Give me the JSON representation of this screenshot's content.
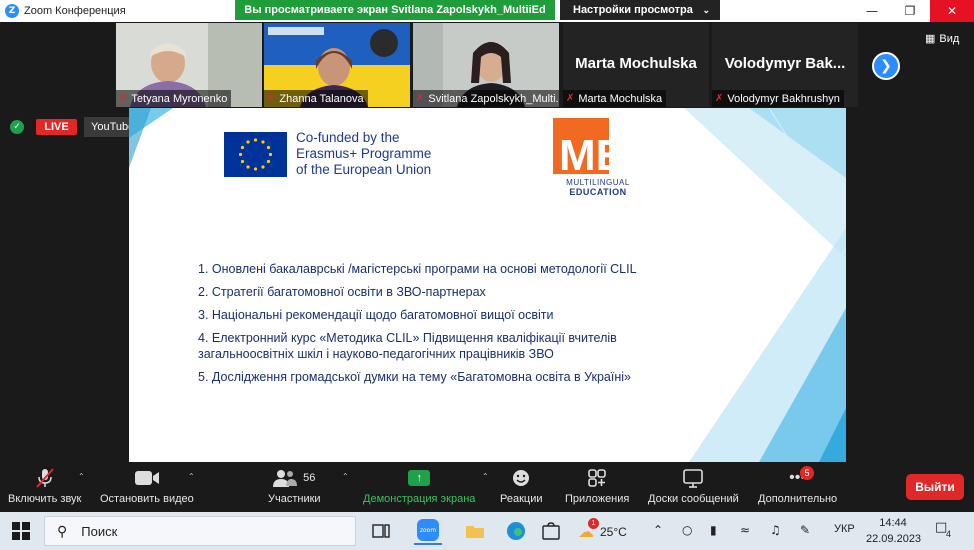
{
  "window": {
    "title": "Zoom Конференция",
    "share_banner": "Вы просматриваете экран Svitlana Zapolskykh_MultiiEd",
    "view_settings": "Настройки просмотра"
  },
  "gallery": {
    "participants": [
      {
        "name": "Tetyana Myronenko",
        "muted": true
      },
      {
        "name": "Zhanna Talanova",
        "muted": true
      },
      {
        "name": "Svitlana Zapolskykh_Multi...",
        "muted": true
      },
      {
        "name": "Marta Mochulska",
        "big_name": "Marta Mochulska",
        "muted": true
      },
      {
        "name": "Volodymyr Bakhrushyn",
        "big_name": "Volodymyr Bak...",
        "muted": true
      }
    ],
    "view_label": "Вид"
  },
  "live": {
    "badge": "LIVE",
    "platform": "YouTube"
  },
  "slide": {
    "cofunded_lines": [
      "Co-funded by the",
      "Erasmus+ Programme",
      "of the European Union"
    ],
    "logo_letters": "ME",
    "logo_sub1": "MULTILINGUAL",
    "logo_sub2": "EDUCATION",
    "items": [
      "1. Оновлені бакалаврські /магістерські програми на основі методології CLIL",
      "2. Стратегії багатомовної освіти в ЗВО-партнерах",
      "3. Національні рекомендації щодо багатомовної вищої освіти",
      "4. Електронний курс «Методика CLIL» Підвищення кваліфікації вчителів загальноосвітніх шкіл і науково-педагогічних працівників ЗВО",
      "5. Дослідження громадської думки на тему «Багатомовна освіта в Україні»"
    ]
  },
  "toolbar": {
    "audio": "Включить звук",
    "video": "Остановить видео",
    "participants": "Участники",
    "participants_count": "56",
    "share": "Демонстрация экрана",
    "reactions": "Реакции",
    "apps": "Приложения",
    "whiteboards": "Доски сообщений",
    "more": "Дополнительно",
    "more_badge": "5",
    "leave": "Выйти"
  },
  "taskbar": {
    "search_placeholder": "Поиск",
    "temperature": "25°C",
    "weather_badge": "1",
    "language": "УКР",
    "time": "14:44",
    "date": "22.09.2023",
    "notifications": "4"
  },
  "colors": {
    "zoom_blue": "#2d8cff",
    "share_green": "#1f9d3a",
    "leave_red": "#e02828",
    "slide_text": "#1a2e6e",
    "me_orange": "#f26a21"
  }
}
